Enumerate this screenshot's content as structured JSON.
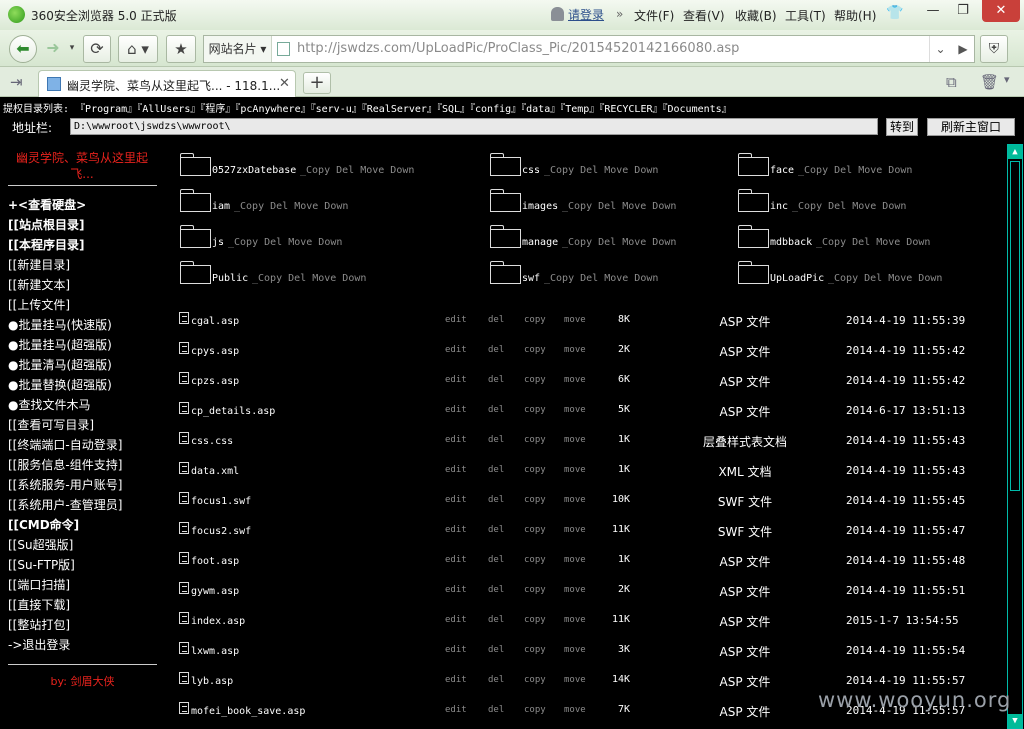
{
  "browser": {
    "title": "360安全浏览器 5.0 正式版",
    "login": "请登录",
    "menus": [
      "文件(F)",
      "查看(V)",
      "收藏(B)",
      "工具(T)",
      "帮助(H)"
    ],
    "favorites_label": "网站名片",
    "url": "http://jswdzs.com/UpLoadPic/ProClass_Pic/20154520142166080.asp",
    "tab_label": "幽灵学院、菜鸟从这里起飞... - 118.1..."
  },
  "shell": {
    "privileged_label": "提权目录列表:",
    "privileged_dirs": [
      "『Program』",
      "『AllUsers』",
      "『程序』",
      "『pcAnywhere』",
      "『serv-u』",
      "『RealServer』",
      "『SQL』",
      "『config』",
      "『data』",
      "『Temp』",
      "『RECYCLER』",
      "『Documents』"
    ],
    "address_label": "地址栏:",
    "address_value": "D:\\wwwroot\\jswdzs\\wwwroot\\",
    "goto_button": "转到",
    "refresh_button": "刷新主窗口",
    "sidebar": {
      "title_line1": "幽灵学院、菜鸟从这里起",
      "title_line2": "飞...",
      "items": [
        "+<查看硬盘>",
        "[[站点根目录]",
        "[[本程序目录]",
        "[[新建目录]",
        "[[新建文本]",
        "[[上传文件]",
        "●批量挂马(快速版)",
        "●批量挂马(超强版)",
        "●批量清马(超强版)",
        "●批量替换(超强版)",
        "●查找文件木马",
        "[[查看可写目录]",
        "[[终端端口-自动登录]",
        "[[服务信息-组件支持]",
        "[[系统服务-用户账号]",
        "[[系统用户-查管理员]",
        "[[CMD命令]",
        "[[Su超强版]",
        "[[Su-FTP版]",
        "[[端口扫描]",
        "[[直接下载]",
        "[[整站打包]",
        "->退出登录"
      ],
      "author": "by: 剑眉大侠"
    },
    "folder_actions": "_Copy Del Move Down",
    "folders": [
      "0527zxDatebase",
      "css",
      "face",
      "iam",
      "images",
      "inc",
      "js",
      "manage",
      "mdbback",
      "Public",
      "swf",
      "UpLoadPic"
    ],
    "file_actions": [
      "edit",
      "del",
      "copy",
      "move"
    ],
    "files": [
      {
        "name": "cgal.asp",
        "size": "8K",
        "type": "ASP 文件",
        "time": "2014-4-19 11:55:39"
      },
      {
        "name": "cpys.asp",
        "size": "2K",
        "type": "ASP 文件",
        "time": "2014-4-19 11:55:42"
      },
      {
        "name": "cpzs.asp",
        "size": "6K",
        "type": "ASP 文件",
        "time": "2014-4-19 11:55:42"
      },
      {
        "name": "cp_details.asp",
        "size": "5K",
        "type": "ASP 文件",
        "time": "2014-6-17 13:51:13"
      },
      {
        "name": "css.css",
        "size": "1K",
        "type": "层叠样式表文档",
        "time": "2014-4-19 11:55:43"
      },
      {
        "name": "data.xml",
        "size": "1K",
        "type": "XML 文档",
        "time": "2014-4-19 11:55:43"
      },
      {
        "name": "focus1.swf",
        "size": "10K",
        "type": "SWF 文件",
        "time": "2014-4-19 11:55:45"
      },
      {
        "name": "focus2.swf",
        "size": "11K",
        "type": "SWF 文件",
        "time": "2014-4-19 11:55:47"
      },
      {
        "name": "foot.asp",
        "size": "1K",
        "type": "ASP 文件",
        "time": "2014-4-19 11:55:48"
      },
      {
        "name": "gywm.asp",
        "size": "2K",
        "type": "ASP 文件",
        "time": "2014-4-19 11:55:51"
      },
      {
        "name": "index.asp",
        "size": "11K",
        "type": "ASP 文件",
        "time": "2015-1-7 13:54:55"
      },
      {
        "name": "lxwm.asp",
        "size": "3K",
        "type": "ASP 文件",
        "time": "2014-4-19 11:55:54"
      },
      {
        "name": "lyb.asp",
        "size": "14K",
        "type": "ASP 文件",
        "time": "2014-4-19 11:55:57"
      },
      {
        "name": "mofei_book_save.asp",
        "size": "7K",
        "type": "ASP 文件",
        "time": "2014-4-19 11:55:57"
      }
    ],
    "watermark": "www.wooyun.org"
  }
}
